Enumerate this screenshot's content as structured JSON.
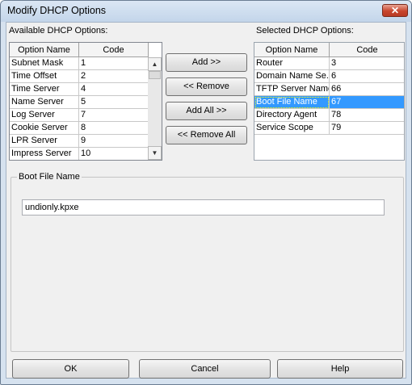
{
  "window": {
    "title": "Modify DHCP Options",
    "close_glyph": "✕"
  },
  "available": {
    "label": "Available DHCP Options:",
    "columns": [
      "Option Name",
      "Code"
    ],
    "rows": [
      {
        "name": "Subnet Mask",
        "code": "1"
      },
      {
        "name": "Time Offset",
        "code": "2"
      },
      {
        "name": "Time Server",
        "code": "4"
      },
      {
        "name": "Name Server",
        "code": "5"
      },
      {
        "name": "Log Server",
        "code": "7"
      },
      {
        "name": "Cookie Server",
        "code": "8"
      },
      {
        "name": "LPR Server",
        "code": "9"
      },
      {
        "name": "Impress Server",
        "code": "10"
      }
    ]
  },
  "actions": {
    "add": "Add >>",
    "remove": "<< Remove",
    "add_all": "Add All >>",
    "remove_all": "<< Remove All"
  },
  "selected": {
    "label": "Selected DHCP Options:",
    "columns": [
      "Option Name",
      "Code"
    ],
    "rows": [
      {
        "name": "Router",
        "code": "3"
      },
      {
        "name": "Domain Name Se...",
        "code": "6"
      },
      {
        "name": "TFTP Server Name",
        "code": "66"
      },
      {
        "name": "Boot File Name",
        "code": "67",
        "selected": true
      },
      {
        "name": "Directory Agent",
        "code": "78"
      },
      {
        "name": "Service Scope",
        "code": "79"
      }
    ]
  },
  "detail": {
    "group_label": "Boot File Name",
    "value": "undionly.kpxe"
  },
  "footer": {
    "ok": "OK",
    "cancel": "Cancel",
    "help": "Help"
  },
  "icons": {
    "close": "close-icon",
    "scroll_up": "scroll-up-arrow-icon",
    "scroll_down": "scroll-down-arrow-icon"
  },
  "colors": {
    "selection": "#3399ff",
    "close_button": "#c8452d",
    "titlebar": "#c3d5ea"
  }
}
